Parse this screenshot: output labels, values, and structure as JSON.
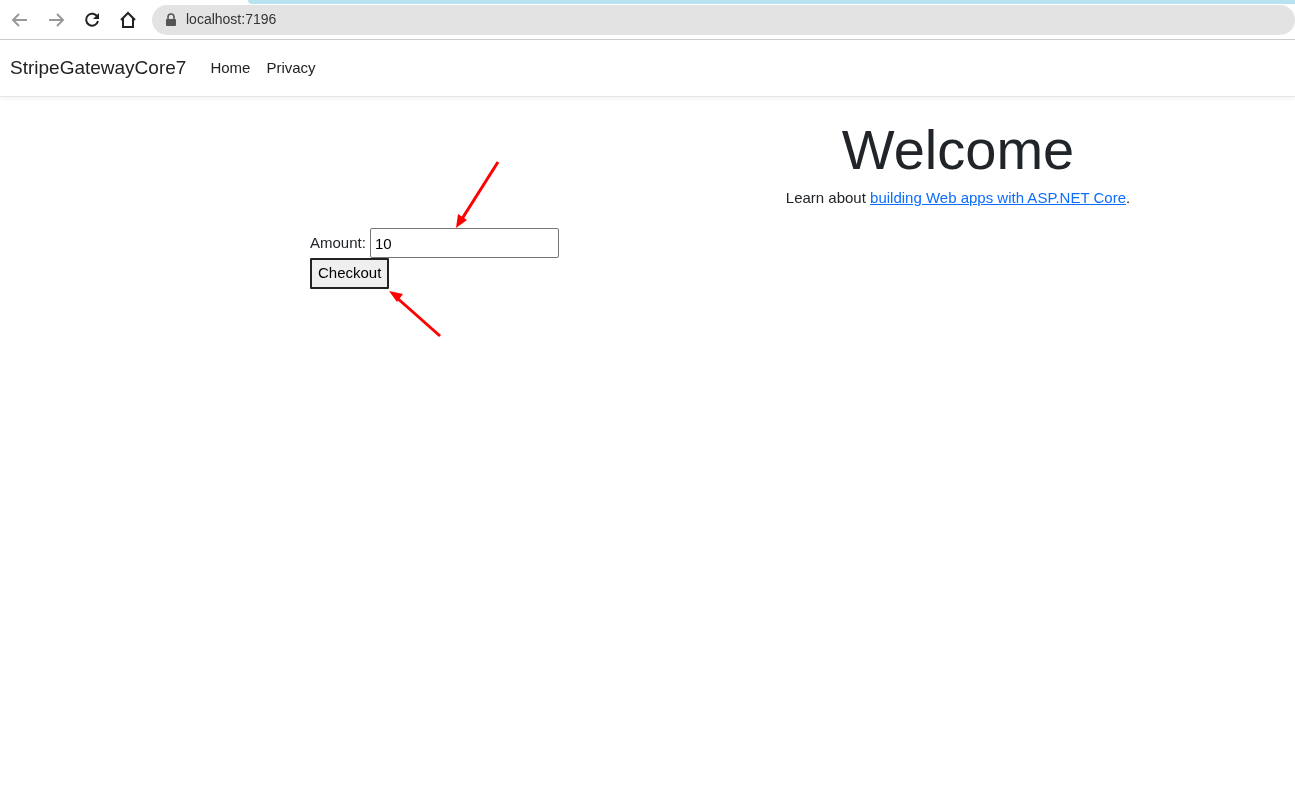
{
  "browser": {
    "url": "localhost:7196"
  },
  "navbar": {
    "brand": "StripeGatewayCore7",
    "links": [
      {
        "label": "Home"
      },
      {
        "label": "Privacy"
      }
    ]
  },
  "form": {
    "label": "Amount:",
    "value": "10",
    "button": "Checkout"
  },
  "welcome": {
    "title": "Welcome",
    "text_before": "Learn about ",
    "link": "building Web apps with ASP.NET Core",
    "text_after": "."
  }
}
